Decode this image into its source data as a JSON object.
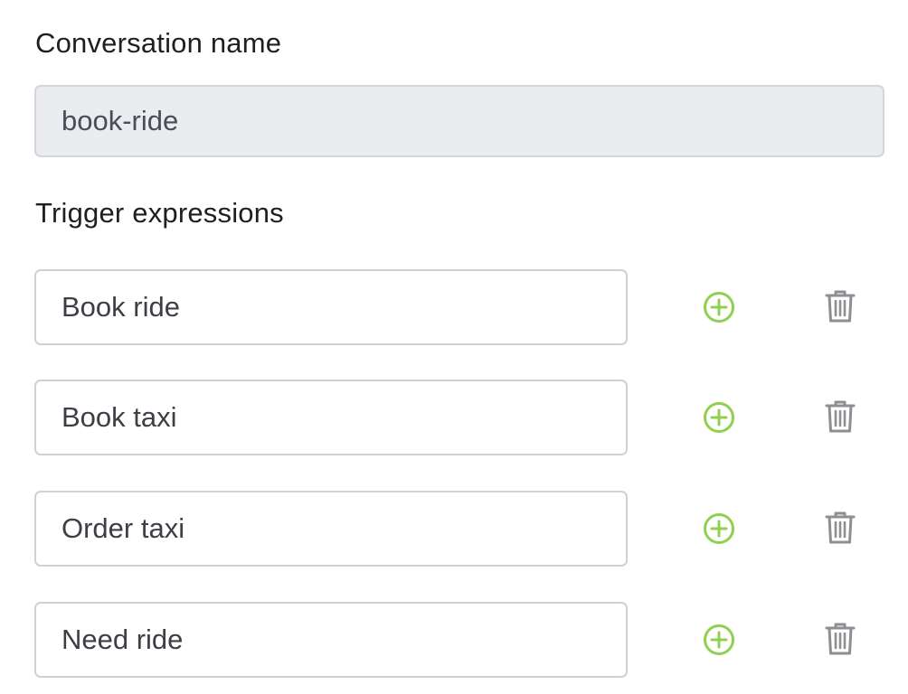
{
  "conversation": {
    "label": "Conversation name",
    "value": "book-ride"
  },
  "triggers": {
    "label": "Trigger expressions",
    "items": [
      {
        "value": "Book ride"
      },
      {
        "value": "Book taxi"
      },
      {
        "value": "Order taxi"
      },
      {
        "value": "Need ride"
      }
    ]
  },
  "icons": {
    "add": "plus-circle-icon",
    "delete": "trash-icon"
  },
  "colors": {
    "add_icon": "#8fd14f",
    "delete_icon": "#8e8e93",
    "readonly_field_bg": "#ebecef"
  }
}
